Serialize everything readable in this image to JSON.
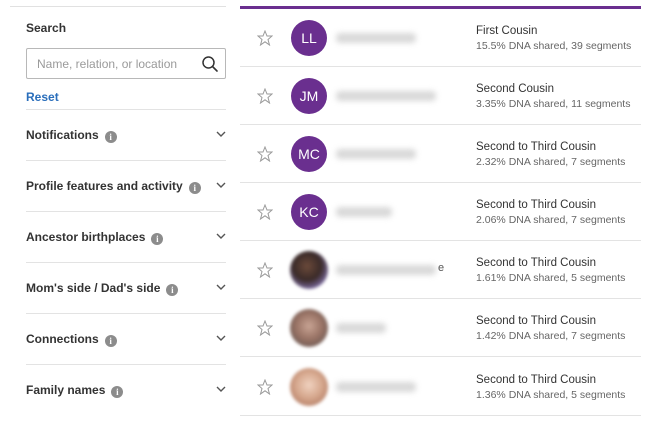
{
  "sidebar": {
    "search_label": "Search",
    "search_placeholder": "Name, relation, or location",
    "search_value": "",
    "reset_label": "Reset",
    "filters": [
      {
        "label": "Notifications"
      },
      {
        "label": "Profile features and activity"
      },
      {
        "label": "Ancestor birthplaces"
      },
      {
        "label": "Mom's side / Dad's side"
      },
      {
        "label": "Connections"
      },
      {
        "label": "Family names"
      }
    ]
  },
  "colors": {
    "accent_purple": "#6a2f8f",
    "link_blue": "#2a6ebb"
  },
  "matches": [
    {
      "initials": "LL",
      "relationship": "First Cousin",
      "dna": "15.5% DNA shared, 39 segments",
      "avatar_type": "initials"
    },
    {
      "initials": "JM",
      "relationship": "Second Cousin",
      "dna": "3.35% DNA shared, 11 segments",
      "avatar_type": "initials"
    },
    {
      "initials": "MC",
      "relationship": "Second to Third Cousin",
      "dna": "2.32% DNA shared, 7 segments",
      "avatar_type": "initials"
    },
    {
      "initials": "KC",
      "relationship": "Second to Third Cousin",
      "dna": "2.06% DNA shared, 7 segments",
      "avatar_type": "initials"
    },
    {
      "initials": "",
      "relationship": "Second to Third Cousin",
      "dna": "1.61% DNA shared, 5 segments",
      "avatar_type": "photo",
      "name_fragment": "e"
    },
    {
      "initials": "",
      "relationship": "Second to Third Cousin",
      "dna": "1.42% DNA shared, 7 segments",
      "avatar_type": "photo"
    },
    {
      "initials": "",
      "relationship": "Second to Third Cousin",
      "dna": "1.36% DNA shared, 5 segments",
      "avatar_type": "photo"
    }
  ]
}
